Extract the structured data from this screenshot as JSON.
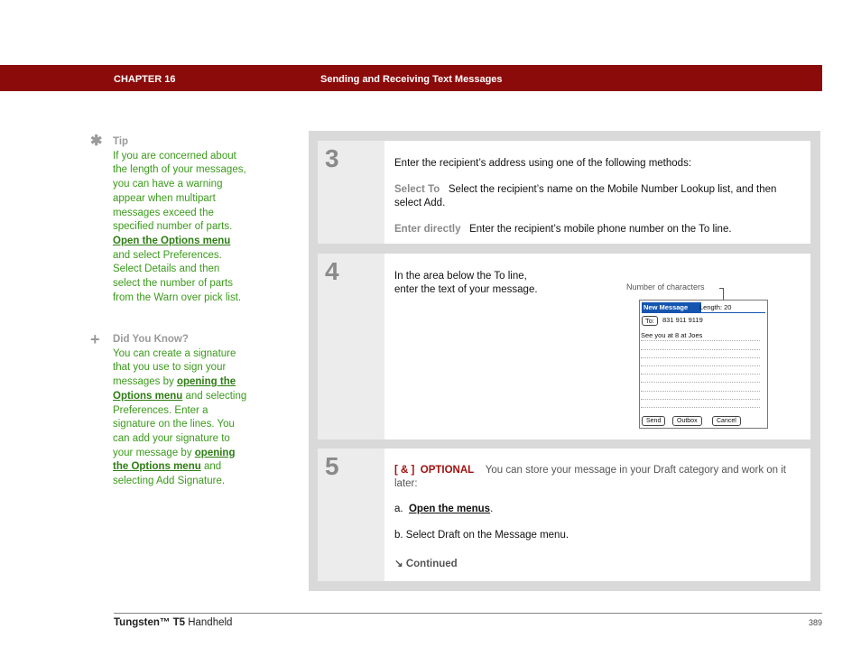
{
  "header": {
    "chapter": "CHAPTER 16",
    "title": "Sending and Receiving Text Messages"
  },
  "tip": {
    "icon": "asterisk-icon",
    "heading": "Tip",
    "text_a": "If you are concerned about the length of your messages, you can have a warning appear when multipart messages exceed the specified number of parts. ",
    "link_a": "Open the Options menu",
    "text_b": " and select Preferences. Select Details and then select the number of parts from the Warn over pick list."
  },
  "did_you_know": {
    "icon": "plus-icon",
    "heading": "Did You Know?",
    "text_a": "You can create a signature that you use to sign your messages by ",
    "link_a": "opening the Options menu",
    "text_b": " and selecting Preferences. Enter a signature on the lines. You can add your signature to your message by ",
    "link_b": "opening the Options menu",
    "text_c": " and selecting Add Signature."
  },
  "steps": [
    {
      "number": "3",
      "intro": "Enter the recipient’s address using one of the following methods:",
      "methods": [
        {
          "label": "Select To",
          "text": "Select the recipient’s name on the Mobile Number Lookup list, and then select Add."
        },
        {
          "label": "Enter directly",
          "text": "Enter the recipient’s mobile phone number on the To line."
        }
      ]
    },
    {
      "number": "4",
      "text_line1": "In the area below the To line,",
      "text_line2": "enter the text of your message.",
      "callout": "Number of characters",
      "device": {
        "title": "New Message",
        "length": "Length: 20",
        "to_label": "To:",
        "to_value": "831 911 9119",
        "message": "See you at 8 at Joes",
        "buttons": [
          "Send",
          "Outbox",
          "Cancel"
        ]
      }
    },
    {
      "number": "5",
      "tag": "[ & ]",
      "optional": "OPTIONAL",
      "text": "You can store your message in your Draft category and work on it later:",
      "item_a_prefix": "a.",
      "item_a_link": "Open the menus",
      "item_a_suffix": ".",
      "item_b": "b.  Select Draft on the Message menu.",
      "continued": "Continued"
    }
  ],
  "footer": {
    "product": "Tungsten™ T5",
    "product_suffix": " Handheld",
    "page": "389"
  }
}
